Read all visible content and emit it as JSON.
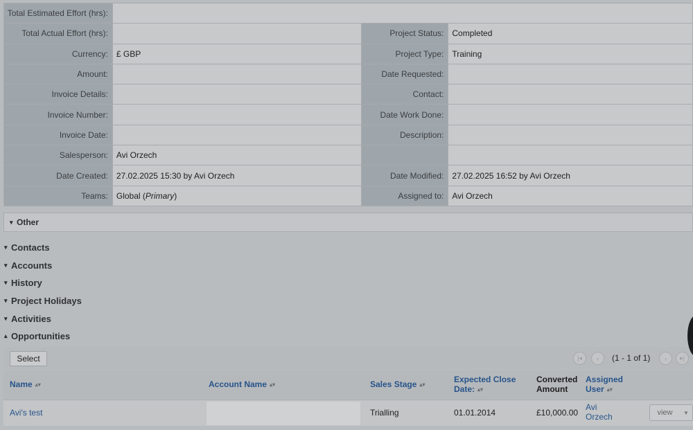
{
  "fields": {
    "total_estimated_effort": {
      "label": "Total Estimated Effort (hrs):",
      "value": ""
    },
    "total_actual_effort": {
      "label": "Total Actual Effort (hrs):",
      "value": ""
    },
    "project_status": {
      "label": "Project Status:",
      "value": "Completed"
    },
    "currency": {
      "label": "Currency:",
      "value": "£ GBP"
    },
    "project_type": {
      "label": "Project Type:",
      "value": "Training"
    },
    "amount": {
      "label": "Amount:",
      "value": ""
    },
    "date_requested": {
      "label": "Date Requested:",
      "value": ""
    },
    "invoice_details": {
      "label": "Invoice Details:",
      "value": ""
    },
    "contact": {
      "label": "Contact:",
      "value": ""
    },
    "invoice_number": {
      "label": "Invoice Number:",
      "value": ""
    },
    "date_work_done": {
      "label": "Date Work Done:",
      "value": ""
    },
    "invoice_date": {
      "label": "Invoice Date:",
      "value": ""
    },
    "description": {
      "label": "Description:",
      "value": ""
    },
    "salesperson": {
      "label": "Salesperson:",
      "value": "Avi Orzech"
    },
    "date_created": {
      "label": "Date Created:",
      "value": "27.02.2025 15:30 by Avi Orzech"
    },
    "date_modified": {
      "label": "Date Modified:",
      "value": "27.02.2025 16:52 by Avi Orzech"
    },
    "teams": {
      "label": "Teams:",
      "value": "Global",
      "primary": "Primary"
    },
    "assigned_to": {
      "label": "Assigned to:",
      "value": "Avi Orzech"
    }
  },
  "panels": {
    "other": "Other",
    "contacts": "Contacts",
    "accounts": "Accounts",
    "history": "History",
    "project_holidays": "Project Holidays",
    "activities": "Activities",
    "opportunities": "Opportunities"
  },
  "opportunities": {
    "select_label": "Select",
    "pagination": "(1 - 1 of 1)",
    "columns": {
      "name": "Name",
      "account_name": "Account Name",
      "sales_stage": "Sales Stage",
      "expected_close_1": "Expected Close",
      "expected_close_2": "Date:",
      "converted_1": "Converted",
      "converted_2": "Amount",
      "assigned_1": "Assigned",
      "assigned_2": "User"
    },
    "rows": [
      {
        "name": "Avi's test",
        "account_name": "",
        "sales_stage": "Trialling",
        "expected_close": "01.01.2014",
        "converted_amount": "£10,000.00",
        "assigned_1": "Avi",
        "assigned_2": "Orzech",
        "action": "view"
      }
    ]
  }
}
